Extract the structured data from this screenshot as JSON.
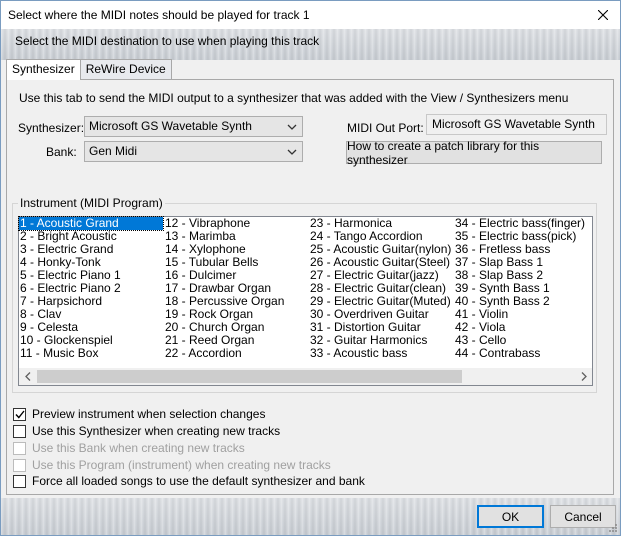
{
  "window": {
    "title": "Select where the MIDI notes should be played for track 1",
    "description": "Select the MIDI destination to use when playing this track"
  },
  "tabs": [
    {
      "label": "Synthesizer",
      "active": true
    },
    {
      "label": "ReWire Device",
      "active": false
    }
  ],
  "synth_tab": {
    "intro": "Use this tab to send the MIDI output to a synthesizer that was added with the View / Synthesizers menu",
    "synth_label": "Synthesizer:",
    "synth_value": "Microsoft GS Wavetable Synth",
    "bank_label": "Bank:",
    "bank_value": "Gen Midi",
    "midi_out_label": "MIDI Out Port:",
    "midi_out_value": "Microsoft GS Wavetable Synth",
    "patch_button": "How to create a patch library for this synthesizer"
  },
  "instrument_group": {
    "legend": "Instrument (MIDI Program)",
    "columns": [
      [
        "1 - Acoustic Grand",
        "2 - Bright Acoustic",
        "3 - Electric Grand",
        "4 - Honky-Tonk",
        "5 - Electric Piano 1",
        "6 - Electric Piano 2",
        "7 - Harpsichord",
        "8 - Clav",
        "9 - Celesta",
        "10 - Glockenspiel",
        "11 - Music Box"
      ],
      [
        "12 - Vibraphone",
        "13 - Marimba",
        "14 - Xylophone",
        "15 - Tubular Bells",
        "16 - Dulcimer",
        "17 - Drawbar Organ",
        "18 - Percussive Organ",
        "19 - Rock Organ",
        "20 - Church Organ",
        "21 - Reed Organ",
        "22 - Accordion"
      ],
      [
        "23 - Harmonica",
        "24 - Tango Accordion",
        "25 - Acoustic Guitar(nylon)",
        "26 - Acoustic Guitar(Steel)",
        "27 - Electric Guitar(jazz)",
        "28 - Electric Guitar(clean)",
        "29 - Electric Guitar(Muted)",
        "30 - Overdriven Guitar",
        "31 - Distortion Guitar",
        "32 - Guitar Harmonics",
        "33 - Acoustic bass"
      ],
      [
        "34 - Electric bass(finger)",
        "35 - Electric bass(pick)",
        "36 - Fretless bass",
        "37 - Slap Bass 1",
        "38 - Slap Bass 2",
        "39 - Synth Bass 1",
        "40 - Synth Bass 2",
        "41 - Violin",
        "42 - Viola",
        "43 - Cello",
        "44 - Contrabass"
      ]
    ],
    "selected": "1 - Acoustic Grand"
  },
  "options": [
    {
      "label": "Preview instrument when selection changes",
      "checked": true,
      "disabled": false
    },
    {
      "label": "Use this Synthesizer when creating new tracks",
      "checked": false,
      "disabled": false
    },
    {
      "label": "Use this Bank when creating new tracks",
      "checked": false,
      "disabled": true
    },
    {
      "label": "Use this Program (instrument) when creating new tracks",
      "checked": false,
      "disabled": true
    },
    {
      "label": "Force all loaded songs to use the default synthesizer and bank",
      "checked": false,
      "disabled": false
    }
  ],
  "buttons": {
    "ok": "OK",
    "cancel": "Cancel"
  },
  "icons": {
    "close": "close-icon",
    "dropdown": "chevron-down-icon",
    "scroll_left": "chevron-left-icon",
    "scroll_right": "chevron-right-icon",
    "check": "checkmark-icon",
    "resize": "resize-grip-icon"
  },
  "colors": {
    "selection": "#0078d7",
    "default_button_border": "#0078d7",
    "disabled_text": "#a0a0a0"
  }
}
